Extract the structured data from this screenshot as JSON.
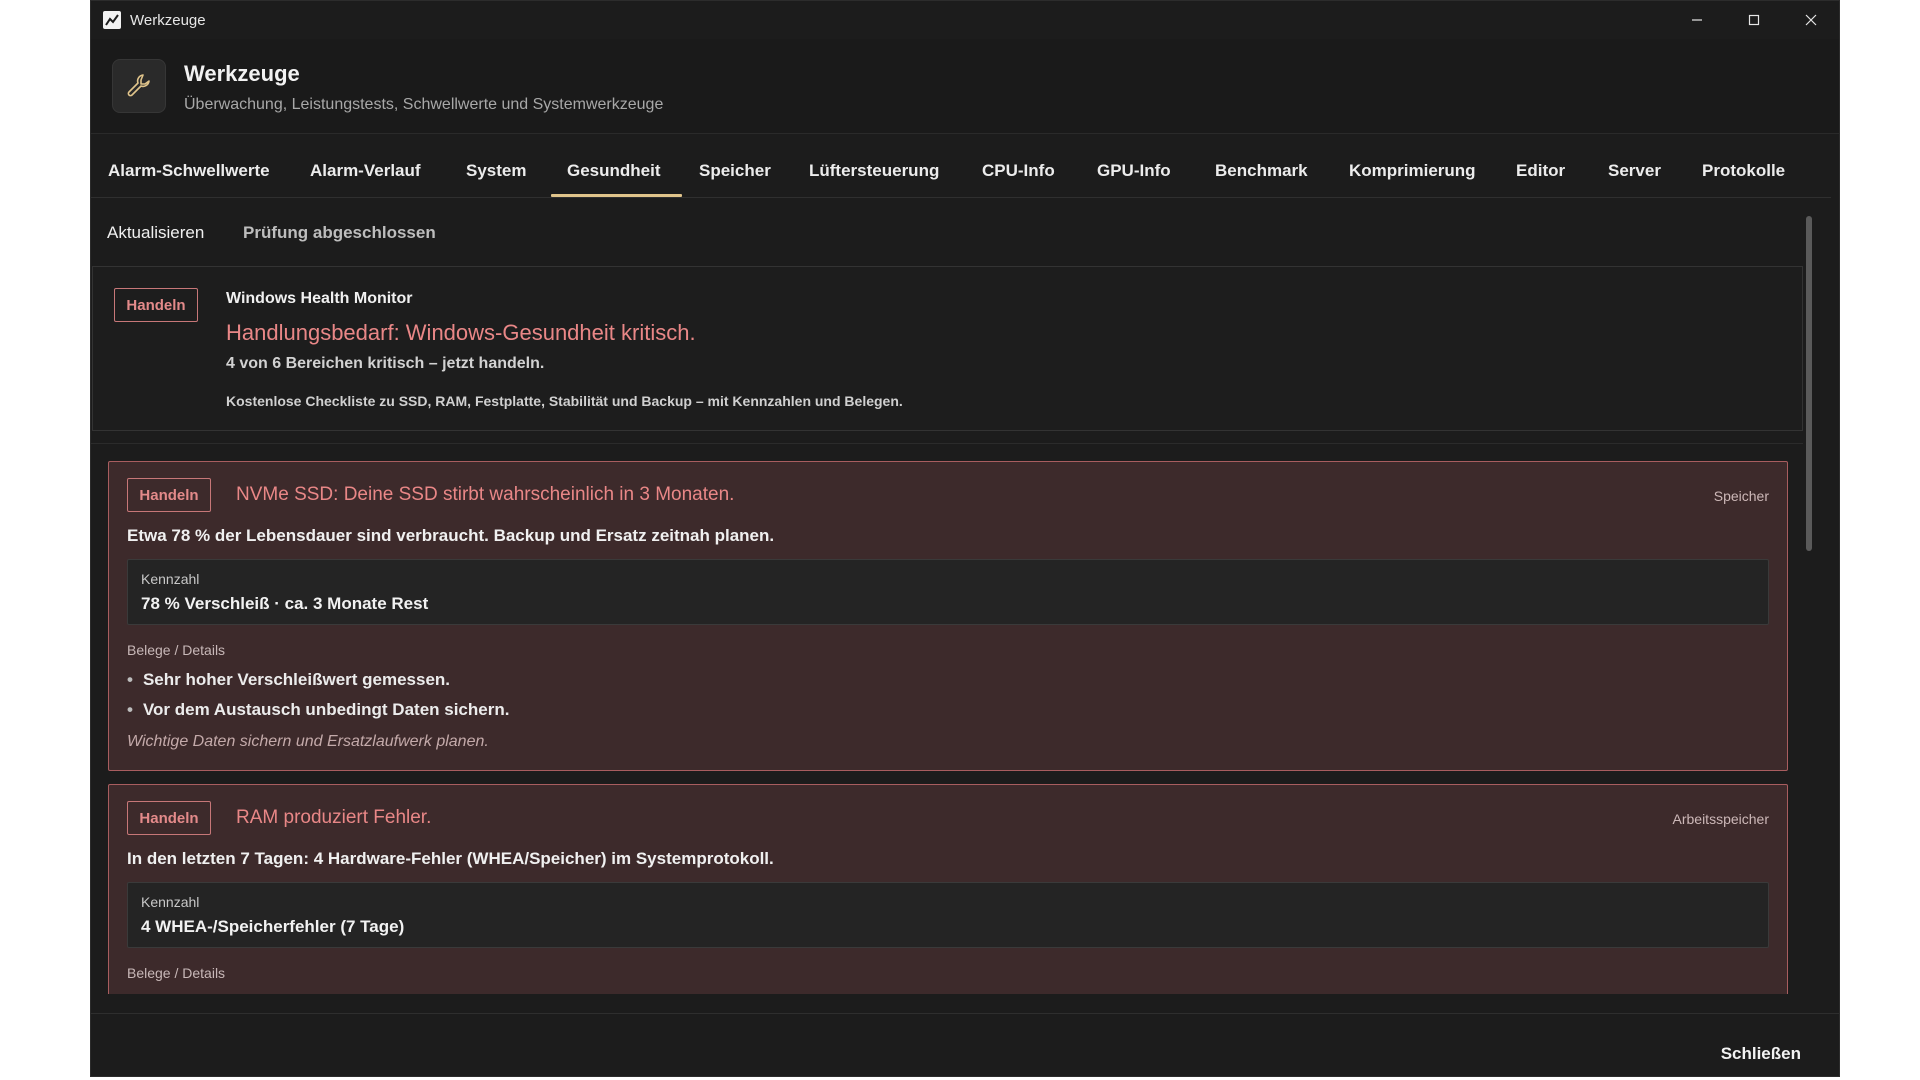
{
  "window": {
    "title": "Werkzeuge",
    "controls": {
      "minimize": "—",
      "maximize": "☐",
      "close": "✕"
    }
  },
  "header": {
    "icon": "wrench-icon",
    "title": "Werkzeuge",
    "subtitle": "Überwachung, Leistungstests, Schwellwerte und Systemwerkzeuge"
  },
  "tabs": [
    {
      "label": "Alarm-Schwellwerte"
    },
    {
      "label": "Alarm-Verlauf"
    },
    {
      "label": "System"
    },
    {
      "label": "Gesundheit",
      "active": true
    },
    {
      "label": "Speicher"
    },
    {
      "label": "Lüftersteuerung"
    },
    {
      "label": "CPU-Info"
    },
    {
      "label": "GPU-Info"
    },
    {
      "label": "Benchmark"
    },
    {
      "label": "Komprimierung"
    },
    {
      "label": "Editor"
    },
    {
      "label": "Server"
    },
    {
      "label": "Protokolle"
    }
  ],
  "toolbar": {
    "refresh": "Aktualisieren",
    "status": "Prüfung abgeschlossen"
  },
  "summary": {
    "badge": "Handeln",
    "source": "Windows Health Monitor",
    "headline": "Handlungsbedarf: Windows-Gesundheit kritisch.",
    "line": "4 von 6 Bereichen kritisch – jetzt handeln.",
    "note": "Kostenlose Checkliste zu SSD, RAM, Festplatte, Stabilität und Backup – mit Kennzahlen und Belegen."
  },
  "cards": [
    {
      "badge": "Handeln",
      "title": "NVMe SSD: Deine SSD stirbt wahrscheinlich in 3 Monaten.",
      "category": "Speicher",
      "description": "Etwa 78 % der Lebensdauer sind verbraucht. Backup und Ersatz zeitnah planen.",
      "kpi_label": "Kennzahl",
      "kpi_value": "78 % Verschleiß · ca. 3 Monate Rest",
      "details_label": "Belege / Details",
      "details": [
        "Sehr hoher Verschleißwert gemessen.",
        "Vor dem Austausch unbedingt Daten sichern."
      ],
      "footer": "Wichtige Daten sichern und Ersatzlaufwerk planen."
    },
    {
      "badge": "Handeln",
      "title": "RAM produziert Fehler.",
      "category": "Arbeitsspeicher",
      "description": "In den letzten 7 Tagen: 4 Hardware-Fehler (WHEA/Speicher) im Systemprotokoll.",
      "kpi_label": "Kennzahl",
      "kpi_value": "4 WHEA-/Speicherfehler (7 Tage)",
      "details_label": "Belege / Details"
    }
  ],
  "footer": {
    "close_label": "Schließen"
  },
  "colors": {
    "window_bg": "#1c1c1c",
    "accent_tab": "#e0c48b",
    "critical": "#e98787",
    "card_bg": "#3d2a2b",
    "card_border": "#a85d5f"
  }
}
